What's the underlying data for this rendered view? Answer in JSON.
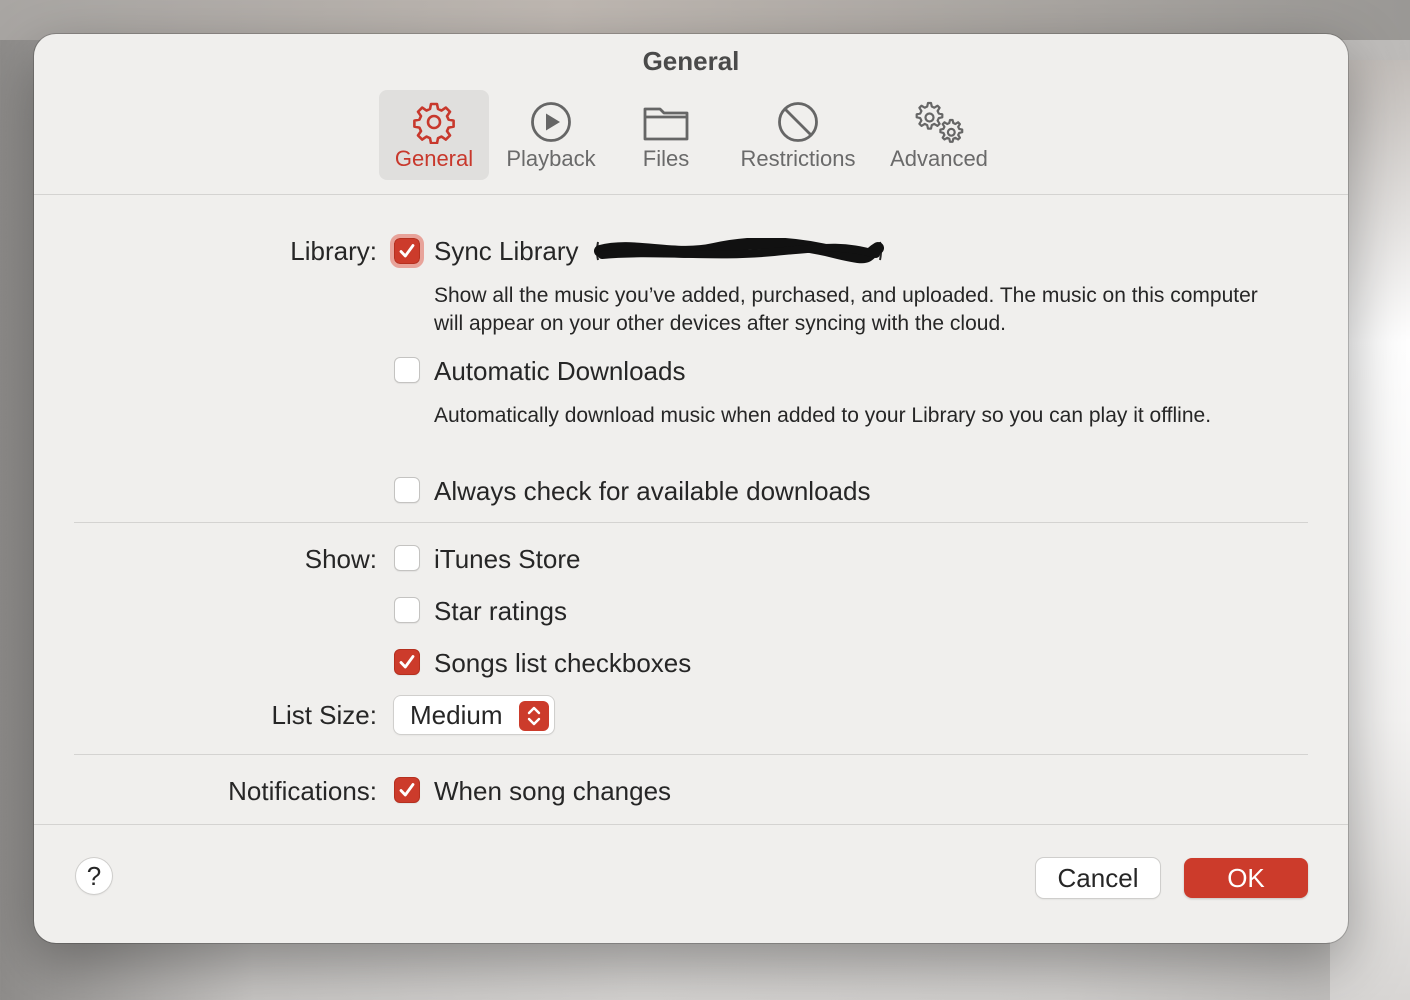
{
  "window": {
    "title": "General"
  },
  "tabs": [
    {
      "label": "General",
      "icon": "gear-icon",
      "selected": true
    },
    {
      "label": "Playback",
      "icon": "play-circle-icon",
      "selected": false
    },
    {
      "label": "Files",
      "icon": "folder-icon",
      "selected": false
    },
    {
      "label": "Restrictions",
      "icon": "prohibited-icon",
      "selected": false
    },
    {
      "label": "Advanced",
      "icon": "gears-icon",
      "selected": false
    }
  ],
  "library": {
    "label": "Library:",
    "sync": {
      "label": "Sync Library",
      "checked": true,
      "focused": true
    },
    "sync_description": "Show all the music you’ve added, purchased, and uploaded. The music on this computer will appear on your other devices after syncing with the cloud.",
    "auto_downloads": {
      "label": "Automatic Downloads",
      "checked": false
    },
    "auto_downloads_description": "Automatically download music when added to your Library so you can play it offline.",
    "always_check": {
      "label": "Always check for available downloads",
      "checked": false
    }
  },
  "show": {
    "label": "Show:",
    "itunes_store": {
      "label": "iTunes Store",
      "checked": false
    },
    "star_ratings": {
      "label": "Star ratings",
      "checked": false
    },
    "songs_checkboxes": {
      "label": "Songs list checkboxes",
      "checked": true
    }
  },
  "list_size": {
    "label": "List Size:",
    "value": "Medium"
  },
  "notifications": {
    "label": "Notifications:",
    "song_changes": {
      "label": "When song changes",
      "checked": true
    }
  },
  "footer": {
    "help": "?",
    "cancel": "Cancel",
    "ok": "OK"
  },
  "colors": {
    "accent": "#cc3b2b",
    "window_bg": "#f0efed",
    "separator": "#d4d3d1"
  }
}
